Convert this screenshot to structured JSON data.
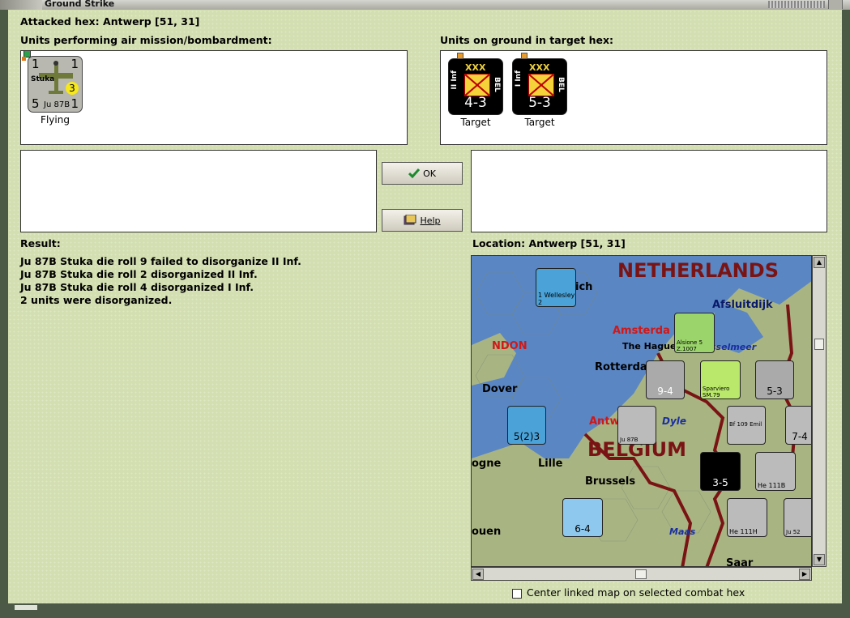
{
  "window": {
    "title": "Ground Strike"
  },
  "attacked_hex": "Attacked hex: Antwerp  [51, 31]",
  "air_units": {
    "label": "Units performing air mission/bombardment:",
    "units": [
      {
        "top_left": "1",
        "top_right": "1",
        "name": "Stuka",
        "badge": "3",
        "bottom_left": "5",
        "model": "Ju 87B",
        "bottom_right": "1",
        "status": "Flying"
      }
    ]
  },
  "ground_units": {
    "label": "Units on ground in target hex:",
    "units": [
      {
        "size": "XXX",
        "name": "II Inf",
        "nation": "BEL",
        "strength": "4-3",
        "status": "Target"
      },
      {
        "size": "XXX",
        "name": "I Inf",
        "nation": "BEL",
        "strength": "5-3",
        "status": "Target"
      }
    ]
  },
  "buttons": {
    "ok": "OK",
    "help": "Help"
  },
  "result": {
    "label": "Result:",
    "lines": [
      "Ju 87B Stuka die roll 9 failed to disorganize II Inf.",
      "Ju 87B Stuka die roll 2 disorganized II Inf.",
      "Ju 87B Stuka die roll 4 disorganized I Inf.",
      "2 units were disorganized."
    ]
  },
  "location": {
    "label": "Location:  Antwerp  [51, 31]",
    "map_labels": {
      "netherlands": "NETHERLANDS",
      "belgium": "BELGIUM",
      "afsluitdijk": "Afsluitdijk",
      "amsterdam": "Amsterda",
      "the_hague": "The Hague",
      "ijsselmeer": "sselmeer",
      "rotterdam": "Rotterda",
      "dover": "Dover",
      "london": "NDON",
      "antwerp": "Antw",
      "dyle": "Dyle",
      "lille": "Lille",
      "brussels": "Brussels",
      "boulogne": "ogne",
      "maas": "Maas",
      "ouen": "ouen",
      "saar": "Saar",
      "wich": "ich"
    },
    "map_counters": [
      "1 Wellesley 2",
      "Alsione 5 Z.1007",
      "Sparviero SM.79",
      "9-4",
      "5-3",
      "5(2)3",
      "Ju 87B",
      "Bf 109 Emil",
      "7-4",
      "3-5",
      "He 111B",
      "He 111H",
      "6-4",
      "Ju 52"
    ]
  },
  "center_checkbox": {
    "label": "Center linked map on selected combat hex",
    "checked": false
  },
  "colors": {
    "panel": "#d3dfb1",
    "sea": "#5a86c4",
    "land": "#a9b483",
    "border_red": "#7a1414"
  }
}
